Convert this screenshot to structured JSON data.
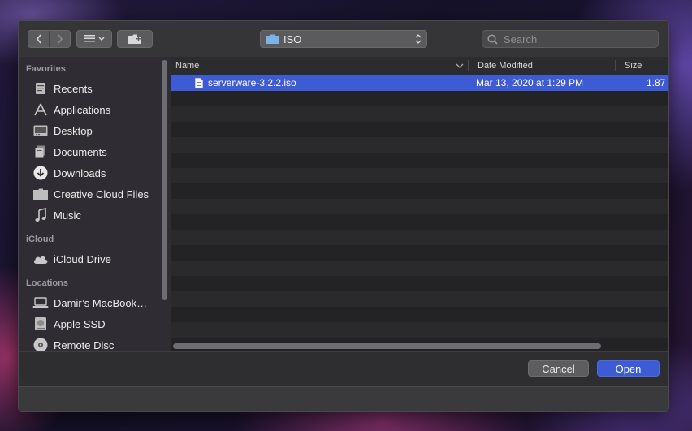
{
  "toolbar": {
    "path_folder": "ISO",
    "search_placeholder": "Search"
  },
  "sidebar": {
    "favorites_title": "Favorites",
    "favorites": [
      {
        "label": "Recents",
        "icon": "clock-icon"
      },
      {
        "label": "Applications",
        "icon": "applications-icon"
      },
      {
        "label": "Desktop",
        "icon": "desktop-icon"
      },
      {
        "label": "Documents",
        "icon": "documents-icon"
      },
      {
        "label": "Downloads",
        "icon": "download-icon"
      },
      {
        "label": "Creative Cloud Files",
        "icon": "folder-icon"
      },
      {
        "label": "Music",
        "icon": "music-note-icon"
      }
    ],
    "icloud_title": "iCloud",
    "icloud": [
      {
        "label": "iCloud Drive",
        "icon": "cloud-icon"
      }
    ],
    "locations_title": "Locations",
    "locations": [
      {
        "label": "Damir’s MacBook…",
        "icon": "laptop-icon"
      },
      {
        "label": "Apple SSD",
        "icon": "hard-drive-icon"
      },
      {
        "label": "Remote Disc",
        "icon": "disc-icon"
      }
    ]
  },
  "columns": {
    "name": "Name",
    "date_modified": "Date Modified",
    "size": "Size"
  },
  "files": [
    {
      "name": "serverware-3.2.2.iso",
      "date_modified": "Mar 13, 2020 at 1:29 PM",
      "size": "1.87"
    }
  ],
  "footer": {
    "cancel_label": "Cancel",
    "open_label": "Open"
  },
  "colors": {
    "accent": "#3d5bd4",
    "folder_blue": "#7db3e8"
  }
}
